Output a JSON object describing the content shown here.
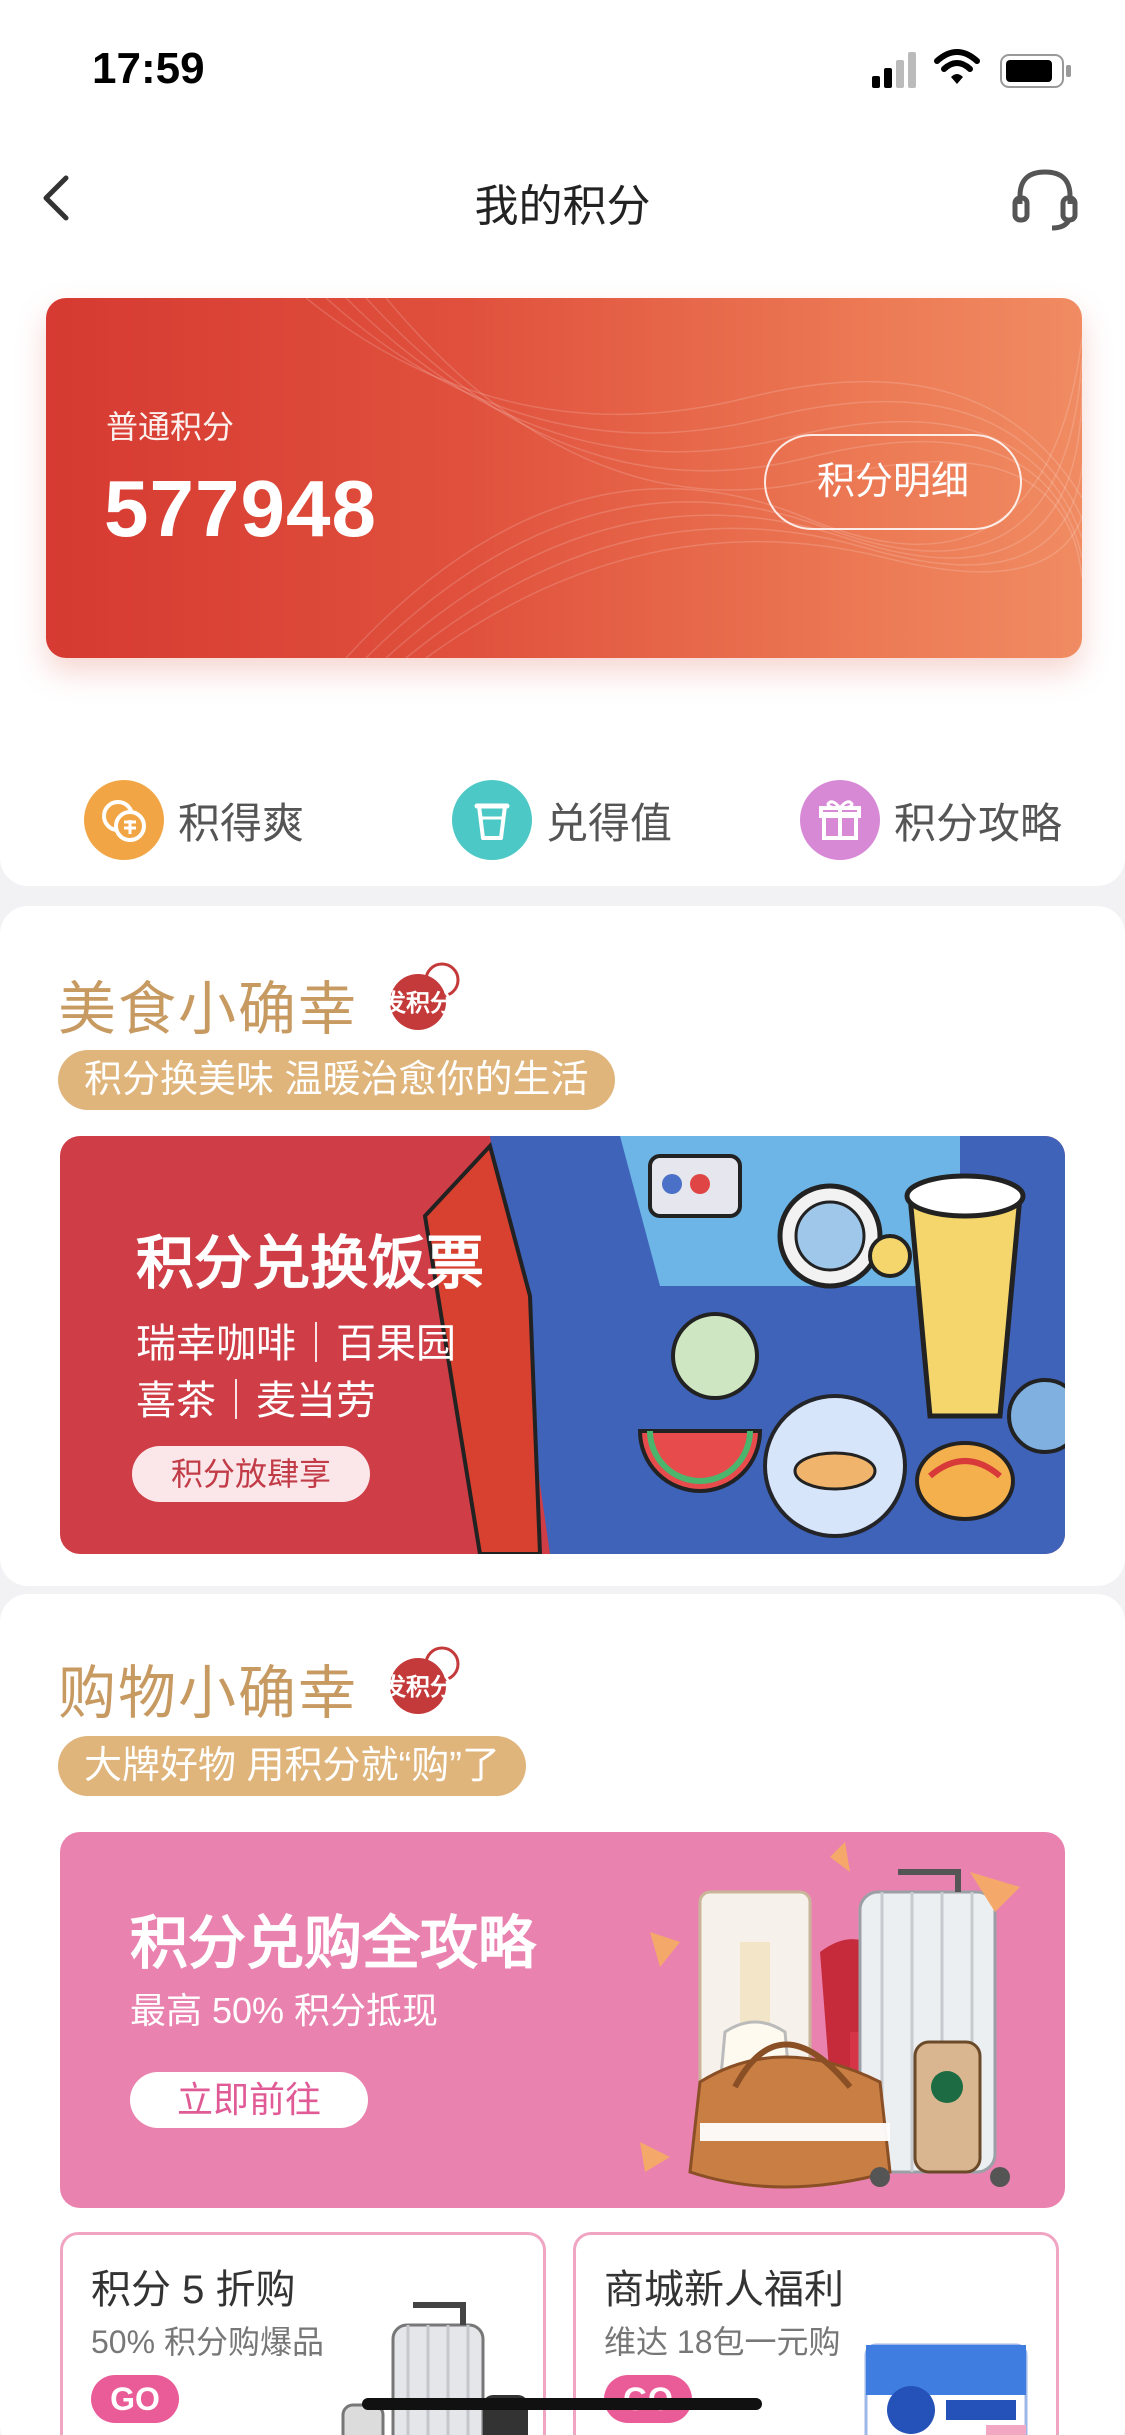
{
  "status_bar": {
    "time": "17:59"
  },
  "nav": {
    "title": "我的积分"
  },
  "points_card": {
    "label": "普通积分",
    "value": "577948",
    "detail_button": "积分明细"
  },
  "quick_links": [
    {
      "label": "积得爽",
      "icon": "coins-icon",
      "color": "#f1a544"
    },
    {
      "label": "兑得值",
      "icon": "cup-icon",
      "color": "#4cc9c6"
    },
    {
      "label": "积分攻略",
      "icon": "gift-icon",
      "color": "#d889d6"
    }
  ],
  "food_section": {
    "title": "美食小确幸",
    "seal_text": "发积分",
    "subtitle": "积分换美味  温暖治愈你的生活",
    "banner": {
      "heading": "积分兑换饭票",
      "line1": "瑞幸咖啡｜百果园",
      "line2": "喜茶｜麦当劳",
      "button": "积分放肆享"
    }
  },
  "shop_section": {
    "title": "购物小确幸",
    "seal_text": "发积分",
    "subtitle": "大牌好物  用积分就“购”了",
    "banner": {
      "heading": "积分兑购全攻略",
      "line": "最高 50% 积分抵现",
      "button": "立即前往"
    },
    "promos": [
      {
        "title": "积分 5 折购",
        "subtitle": "50% 积分购爆品",
        "cta": "GO"
      },
      {
        "title": "商城新人福利",
        "subtitle": "维达 18包一元购",
        "cta": "GO"
      }
    ]
  },
  "colors": {
    "card_start": "#d63a32",
    "card_end": "#f08b62",
    "section_title": "#c79a62",
    "pill": "#dfb57b",
    "food_banner": "#cf3d46",
    "shop_banner": "#ea82b0"
  }
}
